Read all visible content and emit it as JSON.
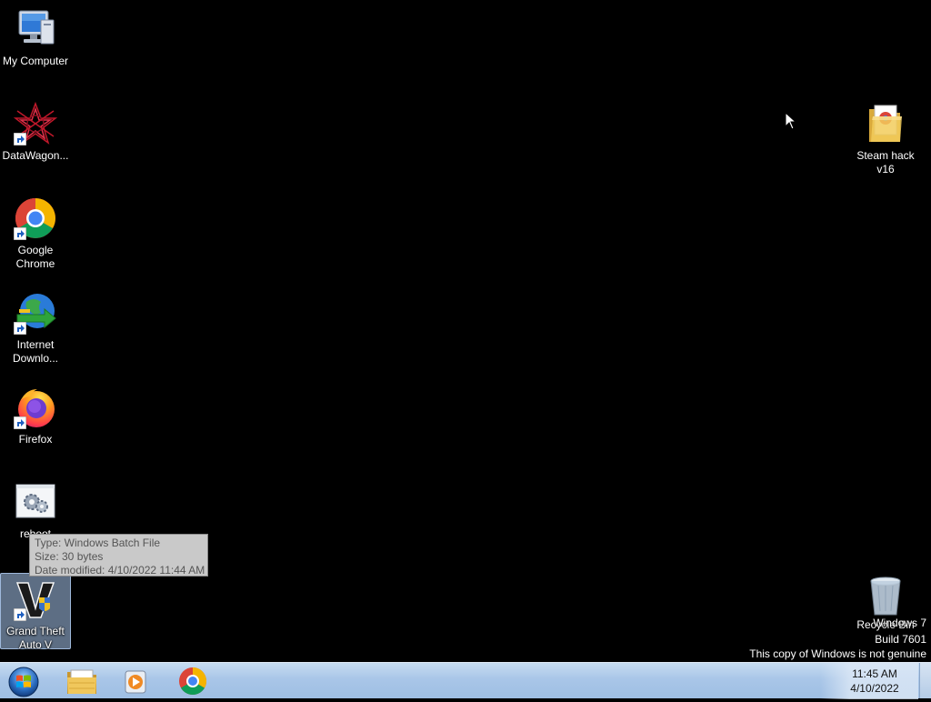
{
  "desktop": {
    "icons": {
      "my_computer": {
        "label": "My Computer",
        "icon": "computer-icon"
      },
      "datawagon": {
        "label": "DataWagon...",
        "icon": "datawagon-icon"
      },
      "chrome": {
        "label1": "Google",
        "label2": "Chrome",
        "icon": "chrome-icon"
      },
      "idm": {
        "label1": "Internet",
        "label2": "Downlo...",
        "icon": "internet-download-manager-icon"
      },
      "firefox": {
        "label": "Firefox",
        "icon": "firefox-icon"
      },
      "reboot": {
        "label": "reboot",
        "icon": "batch-file-icon"
      },
      "gta": {
        "label1": "Grand Theft",
        "label2": "Auto V",
        "icon": "gta-v-icon"
      },
      "steam_hack": {
        "label1": "Steam hack",
        "label2": "v16",
        "icon": "folder-icon"
      },
      "recycle_bin": {
        "label": "Recycle Bin",
        "icon": "recycle-bin-icon"
      }
    },
    "tooltip": {
      "type": "Type: Windows Batch File",
      "size": "Size: 30 bytes",
      "modified": "Date modified: 4/10/2022 11:44 AM"
    },
    "watermark": {
      "line1": "Windows 7",
      "line2": "Build 7601",
      "line3": "This copy of Windows is not genuine"
    }
  },
  "taskbar": {
    "start": "start-orb-icon",
    "pinned": [
      "explorer-icon",
      "media-player-icon",
      "chrome-icon"
    ],
    "clock": {
      "time": "11:45 AM",
      "date": "4/10/2022"
    }
  },
  "colors": {
    "desktop_bg": "#000000",
    "taskbar": "#a9c6e8",
    "tooltip_bg": "#c9c9c9",
    "selection": "#aac8f0"
  }
}
